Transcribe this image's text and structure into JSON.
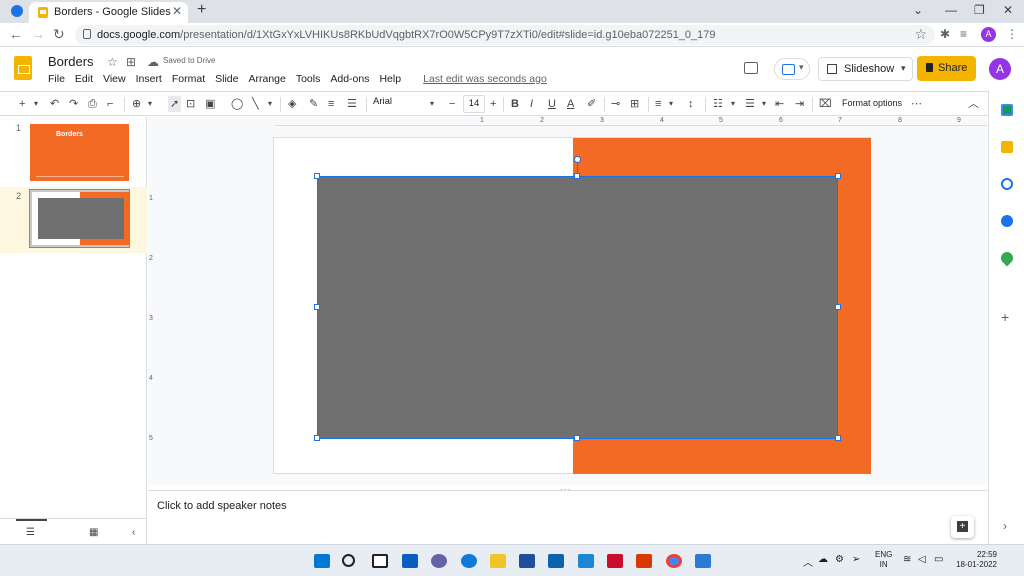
{
  "browser": {
    "tab_title": "Borders - Google Slides",
    "url_host": "docs.google.com",
    "url_path": "/presentation/d/1XtGxYxLVHIKUs8RKbUdVqgbtRX7rO0W5CPy9T7zXTi0/edit#slide=id.g10eba072251_0_179",
    "profile_initial": "A"
  },
  "header": {
    "doc_title": "Borders",
    "saved_status": "Saved to Drive",
    "menu": [
      "File",
      "Edit",
      "View",
      "Insert",
      "Format",
      "Slide",
      "Arrange",
      "Tools",
      "Add-ons",
      "Help"
    ],
    "last_edit": "Last edit was seconds ago",
    "slideshow_label": "Slideshow",
    "share_label": "Share",
    "avatar_initial": "A",
    "brand_color": "#f4b400"
  },
  "toolbar": {
    "font_name": "Arial",
    "font_size": "14",
    "format_options": "Format options"
  },
  "filmstrip": {
    "slides": [
      {
        "number": "1",
        "title": "Borders"
      },
      {
        "number": "2",
        "title": ""
      }
    ],
    "selected_index": 2
  },
  "ruler": {
    "horizontal": [
      "1",
      "2",
      "3",
      "4",
      "5",
      "6",
      "7",
      "8",
      "9"
    ],
    "vertical": [
      "1",
      "2",
      "3",
      "4",
      "5"
    ]
  },
  "slide": {
    "background_color": "#ffffff",
    "orange_color": "#f26a24",
    "shape_color": "#707070",
    "selection_color": "#1a73e8"
  },
  "notes": {
    "placeholder": "Click to add speaker notes"
  },
  "taskbar": {
    "language": "ENG",
    "region": "IN",
    "time": "22:59",
    "date": "18-01-2022"
  }
}
